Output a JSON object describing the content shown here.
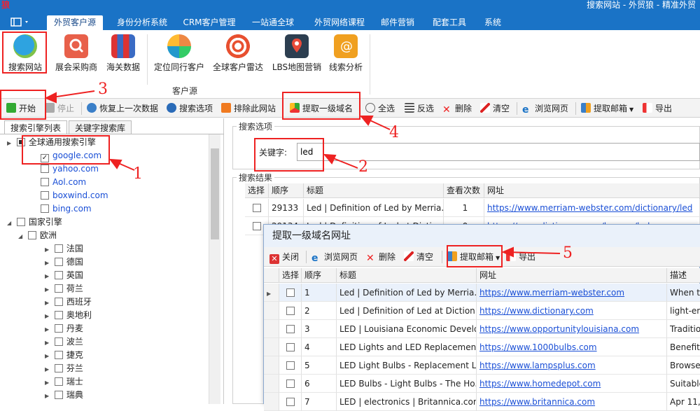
{
  "titlebar": {
    "logo": "狼",
    "title": "搜索网站 - 外贸狼 - 精准外贸"
  },
  "menu_tabs": [
    "外贸客户源",
    "身份分析系统",
    "CRM客户管理",
    "一站通全球",
    "外贸网络课程",
    "邮件营销",
    "配套工具",
    "系统"
  ],
  "ribbon": {
    "buttons": [
      "搜索网站",
      "展会采购商",
      "海关数据",
      "定位同行客户",
      "全球客户雷达",
      "LBS地图营销",
      "线索分析"
    ],
    "group_label": "客户源"
  },
  "toolbar": {
    "start": "开始",
    "stop": "停止",
    "restore": "恢复上一次数据",
    "search_options": "搜索选项",
    "exclude": "排除此网站",
    "extract_domain": "提取一级域名",
    "select_all": "全选",
    "invert": "反选",
    "delete": "删除",
    "clear": "清空",
    "browse": "浏览网页",
    "extract_email": "提取邮箱",
    "export": "导出"
  },
  "left": {
    "tabs": [
      "搜索引擎列表",
      "关键字搜索库"
    ],
    "general_group": "全球通用搜索引擎",
    "engines": [
      {
        "name": "google.com",
        "checked": true
      },
      {
        "name": "yahoo.com",
        "checked": false
      },
      {
        "name": "Aol.com",
        "checked": false
      },
      {
        "name": "boxwind.com",
        "checked": false
      },
      {
        "name": "bing.com",
        "checked": false
      }
    ],
    "country_group": "国家引擎",
    "region": "欧洲",
    "countries": [
      "法国",
      "德国",
      "英国",
      "荷兰",
      "西班牙",
      "奥地利",
      "丹麦",
      "波兰",
      "捷克",
      "芬兰",
      "瑞士",
      "瑞典"
    ]
  },
  "search_options": {
    "legend": "搜索选项",
    "keyword_label": "关键字:",
    "keyword_value": "led"
  },
  "results": {
    "legend": "搜索结果",
    "columns": [
      "选择",
      "顺序",
      "标题",
      "查看次数",
      "网址"
    ],
    "rows": [
      {
        "order": "29133",
        "title": "Led | Definition of Led by Merria...",
        "views": "1",
        "url": "https://www.merriam-webster.com/dictionary/led"
      },
      {
        "order": "29134",
        "title": "Led | Definition of Led at Diction...",
        "views": "0",
        "url": "https://www.dictionary.com/browse/led"
      }
    ]
  },
  "dialog": {
    "title": "提取一级域名网址",
    "toolbar": {
      "close": "关闭",
      "browse": "浏览网页",
      "delete": "删除",
      "clear": "清空",
      "extract_email": "提取邮箱",
      "export": "导出"
    },
    "columns": [
      "选择",
      "顺序",
      "标题",
      "网址",
      "描述"
    ],
    "rows": [
      {
        "order": "1",
        "title": "Led | Definition of Led by Merria...",
        "url": "https://www.merriam-webster.com",
        "desc": "When t"
      },
      {
        "order": "2",
        "title": "Led | Definition of Led at Diction...",
        "url": "https://www.dictionary.com",
        "desc": "light-em"
      },
      {
        "order": "3",
        "title": "LED | Louisiana Economic Develo...",
        "url": "https://www.opportunitylouisiana.com",
        "desc": "Traditio"
      },
      {
        "order": "4",
        "title": "LED Lights and LED Replacemen...",
        "url": "https://www.1000bulbs.com",
        "desc": "Benefits"
      },
      {
        "order": "5",
        "title": "LED Light Bulbs - Replacement L...",
        "url": "https://www.lampsplus.com",
        "desc": "Browse"
      },
      {
        "order": "6",
        "title": "LED Bulbs - Light Bulbs - The Ho...",
        "url": "https://www.homedepot.com",
        "desc": "Suitable"
      },
      {
        "order": "7",
        "title": "LED | electronics | Britannica.com",
        "url": "https://www.britannica.com",
        "desc": "Apr 11,"
      }
    ]
  },
  "annotations": [
    "1",
    "2",
    "3",
    "4",
    "5"
  ],
  "colors": {
    "titlebar": "#1a73c6",
    "annotation": "#e22222",
    "link": "#1a4fd6"
  }
}
